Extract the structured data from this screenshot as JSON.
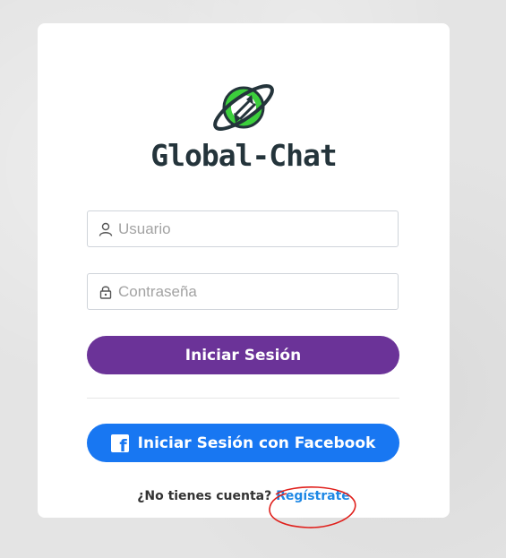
{
  "brand": {
    "name": "Global-Chat",
    "logo_icon": "globe-chat-icon"
  },
  "form": {
    "username": {
      "placeholder": "Usuario",
      "value": "",
      "icon": "user-icon"
    },
    "password": {
      "placeholder": "Contraseña",
      "value": "",
      "icon": "lock-icon"
    },
    "login_label": "Iniciar Sesión",
    "facebook_label": "Iniciar Sesión con Facebook",
    "facebook_icon": "facebook-icon"
  },
  "signup": {
    "prompt": "¿No tienes cuenta?",
    "link_label": "Regístrate"
  },
  "colors": {
    "login_button": "#6b3398",
    "facebook_button": "#1877f2",
    "link": "#1e88e5",
    "annotation": "#e0201c",
    "logo_green": "#3ccf3c",
    "logo_dark": "#24343b"
  }
}
